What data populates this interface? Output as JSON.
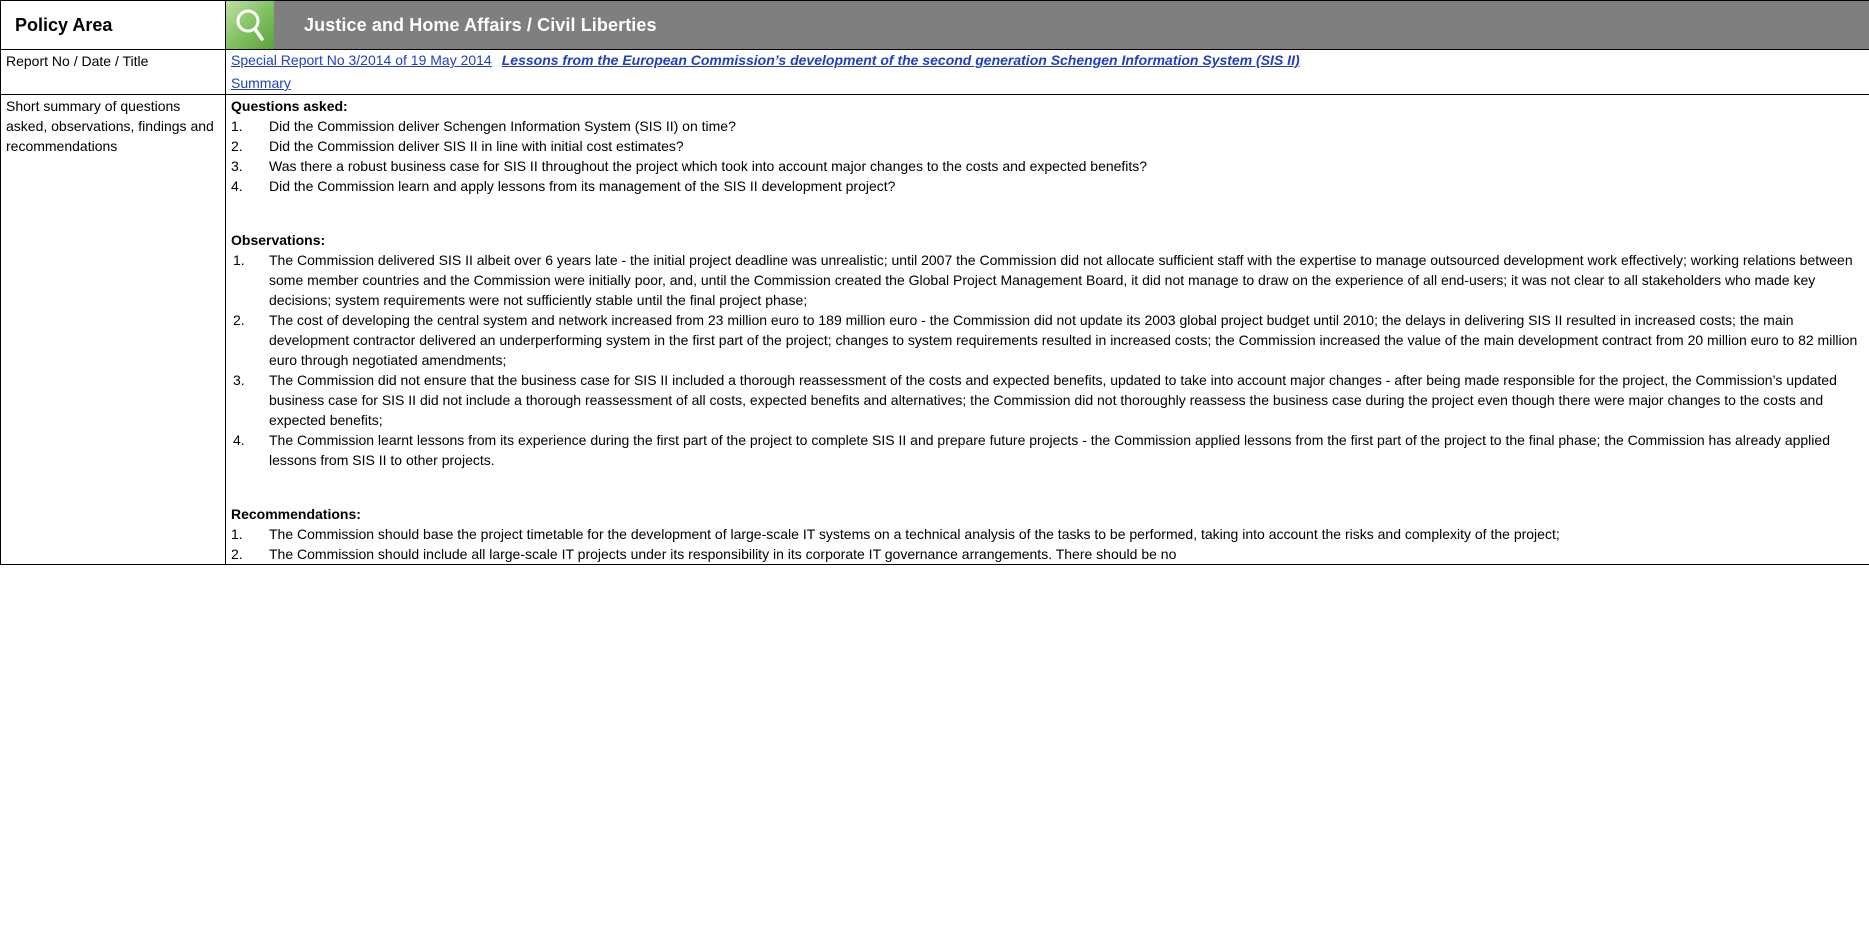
{
  "header": {
    "policy_label": "Policy Area",
    "area_title": "Justice and Home Affairs / Civil Liberties",
    "icon": "magnifier-icon",
    "banner_color": "#7f7f7f",
    "icon_color": "#7dbf5c"
  },
  "report": {
    "label": "Report No / Date / Title",
    "link_text": "Special Report No 3/2014 of 19 May 2014",
    "title_text": "Lessons from the European Commission’s development of the second generation Schengen Information System (SIS II)",
    "summary_link": "Summary",
    "link_color": "#1f3fbf"
  },
  "summary": {
    "label": "Short summary of questions asked, observations, findings and recommendations",
    "questions_heading": "Questions asked:",
    "questions": [
      {
        "num": "1.",
        "text": "Did the Commission deliver Schengen Information System (SIS II) on time?"
      },
      {
        "num": "2.",
        "text": "Did the Commission deliver SIS II in line with initial cost estimates?"
      },
      {
        "num": "3.",
        "text": "Was there a robust business case for SIS II throughout the project which took into account major changes to the costs and expected benefits?"
      },
      {
        "num": "4.",
        "text": "Did the Commission learn and apply lessons from its management of the SIS II development project?"
      }
    ],
    "observations_heading": "Observations:",
    "observations": [
      {
        "num": "1.",
        "text": "The Commission delivered SIS II albeit over 6 years late - the initial project deadline was unrealistic; until 2007 the Commission did not allocate sufficient staff with the expertise to manage outsourced development work effectively; working relations between some member countries and the Commission were initially poor, and, until the Commission created the Global Project Management Board, it did not manage to draw on the experience of all end-users; it was not clear to all stakeholders who made key decisions; system requirements were not sufficiently stable until the final project phase;"
      },
      {
        "num": "2.",
        "text": "The cost of developing the central system and network increased from 23 million euro to 189 million euro - the Commission did not update its 2003 global project budget until 2010; the delays in delivering SIS II resulted in increased costs; the main development contractor delivered an underperforming system in the first part of the project; changes to system requirements resulted in increased costs; the Commission increased the value of the main development contract from 20 million euro to 82 million euro through negotiated amendments;"
      },
      {
        "num": "3.",
        "text": "The Commission did not ensure that the business case for SIS II included a thorough reassessment of the costs and expected benefits, updated to take into account major changes - after being made responsible for the project, the Commission’s updated business case for SIS II did not include a thorough reassessment of all costs, expected benefits and alternatives; the Commission did not thoroughly reassess the business case during the project even though there were major changes to the costs and expected benefits;"
      },
      {
        "num": "4.",
        "text": "The Commission learnt lessons from its experience during the first part of the project to complete SIS II and prepare future projects - the Commission applied lessons from the first part of the project to the final phase; the Commission has already applied lessons from SIS II to other projects."
      }
    ],
    "recommendations_heading": "Recommendations:",
    "recommendations": [
      {
        "num": "1.",
        "text": "The Commission should base the project timetable for the development of large-scale IT systems on a technical analysis of the tasks to be performed, taking into account the risks and complexity of the project;"
      },
      {
        "num": "2.",
        "text": "The Commission should include all large-scale IT projects under its responsibility in its corporate IT governance arrangements. There should be no"
      }
    ]
  }
}
